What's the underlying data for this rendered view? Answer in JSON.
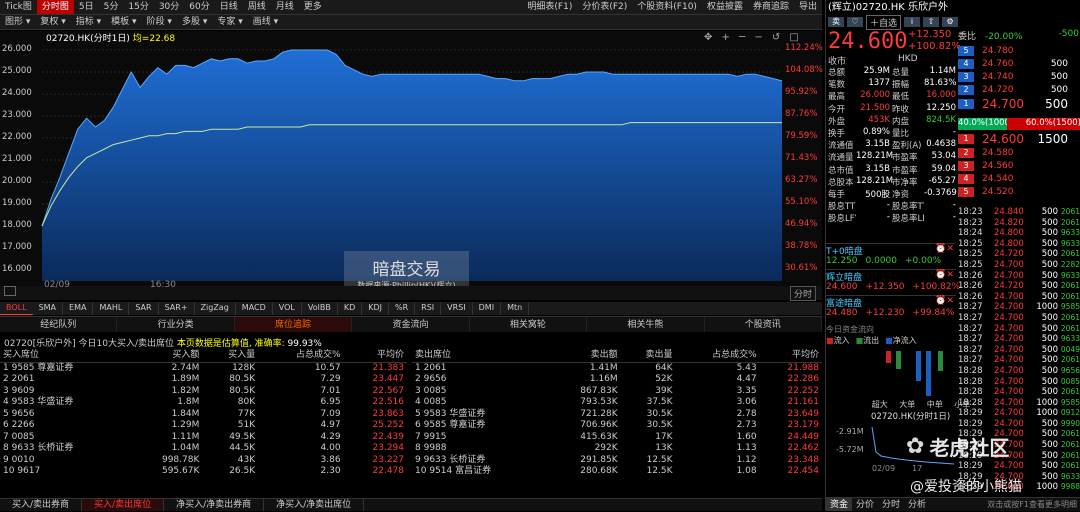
{
  "toolbar": {
    "items": [
      "Tick图",
      "分时图",
      "5日",
      "5分",
      "15分",
      "30分",
      "60分",
      "日线",
      "周线",
      "月线",
      "更多"
    ],
    "active": 1,
    "right": [
      "明细表(F1)",
      "分价表(F2)",
      "个股资料(F10)",
      "权益披露",
      "券商追踪",
      "导出"
    ]
  },
  "subtoolbar": {
    "items": [
      "图形",
      "复权",
      "指标",
      "模板",
      "阶段",
      "多股",
      "专家",
      "画线"
    ]
  },
  "chart": {
    "legend_code": "02720.HK(分时1日)",
    "legend_avg": "均=22.68",
    "watermark_title": "暗盘交易",
    "watermark_sub": "数据来源:Phillip(HK)(辉立)",
    "ylabels": [
      "26.000",
      "25.000",
      "24.000",
      "23.000",
      "22.000",
      "21.000",
      "20.000",
      "19.000",
      "18.000",
      "17.000",
      "16.000"
    ],
    "ylabels_right": [
      "112.24%",
      "104.08%",
      "95.92%",
      "87.76%",
      "79.59%",
      "71.43%",
      "63.27%",
      "55.10%",
      "46.94%",
      "38.78%",
      "30.61%"
    ],
    "date": "02/09",
    "time": "16:30",
    "mode_btn": "分时",
    "price": [
      18.0,
      19.2,
      20.2,
      21.3,
      22.4,
      22.9,
      22.5,
      22.8,
      23.4,
      24.2,
      25.0,
      24.3,
      24.8,
      25.2,
      24.9,
      25.3,
      25.3,
      25.2,
      25.4,
      25.6,
      25.5,
      25.6,
      25.6,
      25.4,
      25.5,
      25.5,
      25.6,
      25.9,
      26.0,
      26.0,
      26.0,
      26.0,
      26.0,
      25.8,
      25.3,
      25.1,
      24.9,
      24.8,
      24.9,
      24.9,
      24.9,
      24.9,
      24.9,
      24.9,
      24.9,
      24.9,
      24.9,
      24.9,
      24.9,
      24.9,
      24.8,
      24.7,
      24.7,
      24.6,
      24.6,
      24.7,
      24.7,
      24.7,
      24.8,
      24.9,
      24.9,
      25.0,
      25.0,
      25.0,
      24.9,
      24.9,
      24.9,
      24.9,
      24.9,
      24.9,
      24.9,
      24.9,
      24.9,
      24.9,
      24.9,
      24.9,
      24.9,
      24.9,
      24.8,
      24.9,
      24.9,
      24.8,
      24.7,
      24.6
    ],
    "avg": [
      18.0,
      18.9,
      19.6,
      20.2,
      20.7,
      21.1,
      21.3,
      21.5,
      21.7,
      21.8,
      21.9,
      22.0,
      22.1,
      22.1,
      22.2,
      22.2,
      22.3,
      22.3,
      22.3,
      22.4,
      22.4,
      22.4,
      22.4,
      22.5,
      22.5,
      22.5,
      22.5,
      22.5,
      22.5,
      22.5,
      22.6,
      22.6,
      22.6,
      22.6,
      22.6,
      22.6,
      22.6,
      22.6,
      22.6,
      22.6,
      22.6,
      22.6,
      22.6,
      22.6,
      22.6,
      22.6,
      22.6,
      22.6,
      22.6,
      22.6,
      22.6,
      22.6,
      22.6,
      22.6,
      22.6,
      22.6,
      22.6,
      22.6,
      22.6,
      22.6,
      22.6,
      22.6,
      22.6,
      22.6,
      22.6,
      22.6,
      22.7,
      22.7,
      22.7,
      22.7,
      22.7,
      22.7,
      22.7,
      22.7,
      22.7,
      22.7,
      22.7,
      22.7,
      22.7,
      22.7,
      22.7,
      22.7,
      22.7,
      22.7
    ]
  },
  "indicators": [
    "BOLL",
    "SMA",
    "EMA",
    "MAHL",
    "SAR",
    "SAR+",
    "ZigZag",
    "MACD",
    "VOL",
    "VolBB",
    "KD",
    "KDJ",
    "%R",
    "RSI",
    "VRSI",
    "DMI",
    "Mtn"
  ],
  "tabs": [
    "经纪队列",
    "行业分类",
    "席位追踪",
    "资金流向",
    "相关窝轮",
    "相关牛熊",
    "个股资讯"
  ],
  "tab_active": 2,
  "notice": {
    "prefix": "02720[乐欣户外] 今日10大买入/卖出席位",
    "warn": "本页数据是估算值, 准确率:",
    "rate": "99.93%"
  },
  "buy": {
    "headers": [
      "买入席位",
      "买入额",
      "买入量",
      "占总成交%",
      "平均价"
    ],
    "rows": [
      [
        "1  9585  尊嘉证券",
        "2.74M",
        "128K",
        "10.57",
        "21.383"
      ],
      [
        "2  2061",
        "1.89M",
        "80.5K",
        "7.29",
        "23.447"
      ],
      [
        "3  9609",
        "1.82M",
        "80.5K",
        "7.01",
        "22.567"
      ],
      [
        "4  9583  华盛证券",
        "1.8M",
        "80K",
        "6.95",
        "22.516"
      ],
      [
        "5  9656",
        "1.84M",
        "77K",
        "7.09",
        "23.863"
      ],
      [
        "6  2266",
        "1.29M",
        "51K",
        "4.97",
        "25.252"
      ],
      [
        "7  0085",
        "1.11M",
        "49.5K",
        "4.29",
        "22.439"
      ],
      [
        "8  9633  长桥证券",
        "1.04M",
        "44.5K",
        "4.00",
        "23.294"
      ],
      [
        "9  0010",
        "998.78K",
        "43K",
        "3.86",
        "23.227"
      ],
      [
        "10  9617",
        "595.67K",
        "26.5K",
        "2.30",
        "22.478"
      ]
    ]
  },
  "sell": {
    "headers": [
      "卖出席位",
      "卖出额",
      "卖出量",
      "占总成交%",
      "平均价"
    ],
    "rows": [
      [
        "1  2061",
        "1.41M",
        "64K",
        "5.43",
        "21.988"
      ],
      [
        "2  9656",
        "1.16M",
        "52K",
        "4.47",
        "22.286"
      ],
      [
        "3  0085",
        "867.83K",
        "39K",
        "3.35",
        "22.252"
      ],
      [
        "4  0085",
        "793.53K",
        "37.5K",
        "3.06",
        "21.161"
      ],
      [
        "5  9583  华盛证券",
        "721.28K",
        "30.5K",
        "2.78",
        "23.649"
      ],
      [
        "6  9585  尊嘉证券",
        "706.96K",
        "30.5K",
        "2.73",
        "23.179"
      ],
      [
        "7  9915",
        "415.63K",
        "17K",
        "1.60",
        "24.449"
      ],
      [
        "8  9988",
        "292K",
        "13K",
        "1.13",
        "22.462"
      ],
      [
        "9  9633  长桥证券",
        "291.85K",
        "12.5K",
        "1.12",
        "23.348"
      ],
      [
        "10  9514  富昌证券",
        "280.68K",
        "12.5K",
        "1.08",
        "22.454"
      ]
    ]
  },
  "bottom_tabs": [
    "买入/卖出券商",
    "买入/卖出席位",
    "净买入/净卖出券商",
    "净买入/净卖出席位"
  ],
  "bottom_active": 1,
  "stock": {
    "title": "(辉立)02720.HK 乐欣户外",
    "tag1": "自选",
    "price": "24.600",
    "chg": "+12.350",
    "pct": "+100.82%",
    "weibi_label": "委比",
    "weibi": "-20.00%",
    "weicha": "-500",
    "shoushi_label": "收市",
    "currency": "HKD",
    "stats": [
      [
        "总额",
        "25.9M",
        "总量",
        "1.14M"
      ],
      [
        "笔数",
        "1377",
        "振幅",
        "81.63%"
      ],
      [
        "最高",
        "26.000",
        "最低",
        "16.000"
      ],
      [
        "今开",
        "21.500",
        "昨收",
        "12.250"
      ],
      [
        "外盘",
        "453K",
        "内盘",
        "824.5K"
      ],
      [
        "换手",
        "0.89%",
        "量比",
        "-"
      ],
      [
        "流通值",
        "3.15B",
        "盈利(A)",
        "0.4638"
      ],
      [
        "流通量",
        "128.21M",
        "市盈率",
        "53.04"
      ],
      [
        "总市值",
        "3.15B",
        "市盈率",
        "59.04"
      ],
      [
        "总股本",
        "128.21M",
        "市净率",
        "-65.27"
      ],
      [
        "每手",
        "500股",
        "净资",
        "-0.3769"
      ],
      [
        "股息TTM",
        "-",
        "股息率TTM",
        "-"
      ],
      [
        "股息LFY",
        "-",
        "股息率LFY",
        "-"
      ]
    ],
    "asks": [
      [
        "5",
        "24.780",
        ""
      ],
      [
        "4",
        "24.760",
        "500"
      ],
      [
        "3",
        "24.740",
        "500"
      ],
      [
        "2",
        "24.720",
        "500"
      ],
      [
        "1",
        "24.700",
        "500"
      ]
    ],
    "ratio_l": "40.0%(1000)",
    "ratio_r": "60.0%(1500)",
    "bids": [
      [
        "1",
        "24.600",
        "1500"
      ],
      [
        "2",
        "24.580",
        ""
      ],
      [
        "3",
        "24.560",
        ""
      ],
      [
        "4",
        "24.540",
        ""
      ],
      [
        "5",
        "24.520",
        ""
      ]
    ],
    "ticks": [
      [
        "18:23",
        "24.840",
        "500",
        "2061"
      ],
      [
        "18:23",
        "24.820",
        "500",
        "2061"
      ],
      [
        "18:24",
        "24.800",
        "500",
        "9633"
      ],
      [
        "18:25",
        "24.800",
        "500",
        "9633"
      ],
      [
        "18:25",
        "24.720",
        "500",
        "2061"
      ],
      [
        "18:25",
        "24.700",
        "500",
        "2282"
      ],
      [
        "18:26",
        "24.700",
        "500",
        "9633"
      ],
      [
        "18:26",
        "24.720",
        "500",
        "2061"
      ],
      [
        "18:26",
        "24.700",
        "500",
        "2061"
      ],
      [
        "18:27",
        "24.700",
        "1000",
        "9585"
      ],
      [
        "18:27",
        "24.700",
        "500",
        "2061"
      ],
      [
        "18:27",
        "24.700",
        "500",
        "2061"
      ],
      [
        "18:27",
        "24.700",
        "500",
        "9633"
      ],
      [
        "18:27",
        "24.700",
        "500",
        "0049"
      ],
      [
        "18:27",
        "24.700",
        "500",
        "2061"
      ],
      [
        "18:28",
        "24.700",
        "500",
        "9656"
      ],
      [
        "18:28",
        "24.700",
        "500",
        "0085"
      ],
      [
        "18:28",
        "24.700",
        "500",
        "2061"
      ],
      [
        "18:28",
        "24.700",
        "1000",
        "9585"
      ],
      [
        "18:29",
        "24.700",
        "1000",
        "0912"
      ],
      [
        "18:29",
        "24.700",
        "500",
        "9990"
      ],
      [
        "18:29",
        "24.700",
        "500",
        "2061"
      ],
      [
        "18:29",
        "24.700",
        "500",
        "2061"
      ],
      [
        "18:29",
        "24.700",
        "500",
        "2061"
      ],
      [
        "18:29",
        "24.700",
        "500",
        "2061"
      ],
      [
        "18:29",
        "24.700",
        "500",
        "9633"
      ],
      [
        "18:29",
        "24.620",
        "1000",
        "9988"
      ]
    ]
  },
  "dark": {
    "t1": "T+0暗盘",
    "v1": [
      "12.250",
      "0.0000",
      "+0.00%"
    ],
    "t2": "辉立暗盘",
    "v2": [
      "24.600",
      "+12.350",
      "+100.82%"
    ],
    "t3": "富途暗盘",
    "v3": [
      "24.480",
      "+12.230",
      "+99.84%"
    ]
  },
  "flow": {
    "title": "今日资金流向",
    "legend": [
      "流入",
      "流出",
      "净流入"
    ],
    "cats": [
      "超大",
      "大单",
      "中单",
      "小单"
    ],
    "mini_title": "02720.HK(分时1日)",
    "mini_y": [
      "-2.91M",
      "-5.72M"
    ],
    "mini_x": [
      "02/09",
      "17"
    ]
  },
  "side_tabs": [
    "资金",
    "分价",
    "分时",
    "分析"
  ],
  "status": "双击或按F1查看更多明细",
  "watermark": {
    "brand": "老虎社区",
    "user": "@爱投资的小熊猫"
  }
}
